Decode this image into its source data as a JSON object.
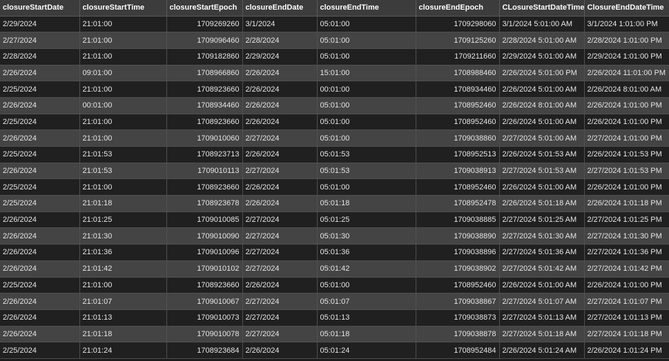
{
  "table": {
    "columns": [
      "closureStartDate",
      "closureStartTime",
      "closureStartEpoch",
      "closureEndDate",
      "closureEndTime",
      "closureEndEpoch",
      "CLosureStartDateTime",
      "ClosureEndDateTime"
    ],
    "rows": [
      [
        "2/29/2024",
        "21:01:00",
        "1709269260",
        "3/1/2024",
        "05:01:00",
        "1709298060",
        "3/1/2024 5:01:00 AM",
        "3/1/2024 1:01:00 PM"
      ],
      [
        "2/27/2024",
        "21:01:00",
        "1709096460",
        "2/28/2024",
        "05:01:00",
        "1709125260",
        "2/28/2024 5:01:00 AM",
        "2/28/2024 1:01:00 PM"
      ],
      [
        "2/28/2024",
        "21:01:00",
        "1709182860",
        "2/29/2024",
        "05:01:00",
        "1709211660",
        "2/29/2024 5:01:00 AM",
        "2/29/2024 1:01:00 PM"
      ],
      [
        "2/26/2024",
        "09:01:00",
        "1708966860",
        "2/26/2024",
        "15:01:00",
        "1708988460",
        "2/26/2024 5:01:00 PM",
        "2/26/2024 11:01:00 PM"
      ],
      [
        "2/25/2024",
        "21:01:00",
        "1708923660",
        "2/26/2024",
        "00:01:00",
        "1708934460",
        "2/26/2024 5:01:00 AM",
        "2/26/2024 8:01:00 AM"
      ],
      [
        "2/26/2024",
        "00:01:00",
        "1708934460",
        "2/26/2024",
        "05:01:00",
        "1708952460",
        "2/26/2024 8:01:00 AM",
        "2/26/2024 1:01:00 PM"
      ],
      [
        "2/25/2024",
        "21:01:00",
        "1708923660",
        "2/26/2024",
        "05:01:00",
        "1708952460",
        "2/26/2024 5:01:00 AM",
        "2/26/2024 1:01:00 PM"
      ],
      [
        "2/26/2024",
        "21:01:00",
        "1709010060",
        "2/27/2024",
        "05:01:00",
        "1709038860",
        "2/27/2024 5:01:00 AM",
        "2/27/2024 1:01:00 PM"
      ],
      [
        "2/25/2024",
        "21:01:53",
        "1708923713",
        "2/26/2024",
        "05:01:53",
        "1708952513",
        "2/26/2024 5:01:53 AM",
        "2/26/2024 1:01:53 PM"
      ],
      [
        "2/26/2024",
        "21:01:53",
        "1709010113",
        "2/27/2024",
        "05:01:53",
        "1709038913",
        "2/27/2024 5:01:53 AM",
        "2/27/2024 1:01:53 PM"
      ],
      [
        "2/25/2024",
        "21:01:00",
        "1708923660",
        "2/26/2024",
        "05:01:00",
        "1708952460",
        "2/26/2024 5:01:00 AM",
        "2/26/2024 1:01:00 PM"
      ],
      [
        "2/25/2024",
        "21:01:18",
        "1708923678",
        "2/26/2024",
        "05:01:18",
        "1708952478",
        "2/26/2024 5:01:18 AM",
        "2/26/2024 1:01:18 PM"
      ],
      [
        "2/26/2024",
        "21:01:25",
        "1709010085",
        "2/27/2024",
        "05:01:25",
        "1709038885",
        "2/27/2024 5:01:25 AM",
        "2/27/2024 1:01:25 PM"
      ],
      [
        "2/26/2024",
        "21:01:30",
        "1709010090",
        "2/27/2024",
        "05:01:30",
        "1709038890",
        "2/27/2024 5:01:30 AM",
        "2/27/2024 1:01:30 PM"
      ],
      [
        "2/26/2024",
        "21:01:36",
        "1709010096",
        "2/27/2024",
        "05:01:36",
        "1709038896",
        "2/27/2024 5:01:36 AM",
        "2/27/2024 1:01:36 PM"
      ],
      [
        "2/26/2024",
        "21:01:42",
        "1709010102",
        "2/27/2024",
        "05:01:42",
        "1709038902",
        "2/27/2024 5:01:42 AM",
        "2/27/2024 1:01:42 PM"
      ],
      [
        "2/25/2024",
        "21:01:00",
        "1708923660",
        "2/26/2024",
        "05:01:00",
        "1708952460",
        "2/26/2024 5:01:00 AM",
        "2/26/2024 1:01:00 PM"
      ],
      [
        "2/26/2024",
        "21:01:07",
        "1709010067",
        "2/27/2024",
        "05:01:07",
        "1709038867",
        "2/27/2024 5:01:07 AM",
        "2/27/2024 1:01:07 PM"
      ],
      [
        "2/26/2024",
        "21:01:13",
        "1709010073",
        "2/27/2024",
        "05:01:13",
        "1709038873",
        "2/27/2024 5:01:13 AM",
        "2/27/2024 1:01:13 PM"
      ],
      [
        "2/26/2024",
        "21:01:18",
        "1709010078",
        "2/27/2024",
        "05:01:18",
        "1709038878",
        "2/27/2024 5:01:18 AM",
        "2/27/2024 1:01:18 PM"
      ],
      [
        "2/25/2024",
        "21:01:24",
        "1708923684",
        "2/26/2024",
        "05:01:24",
        "1708952484",
        "2/26/2024 5:01:24 AM",
        "2/26/2024 1:01:24 PM"
      ]
    ]
  }
}
